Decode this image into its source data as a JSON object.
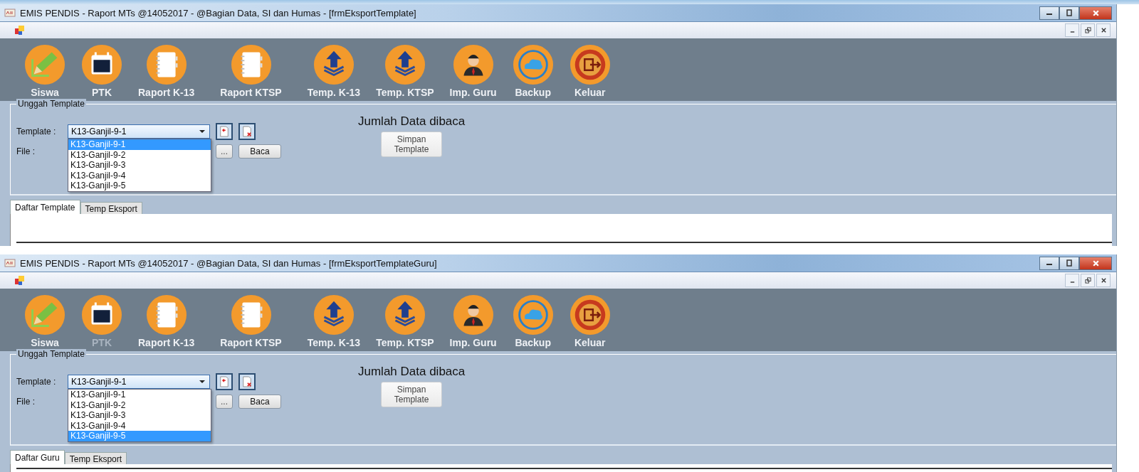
{
  "windows": [
    {
      "title": "EMIS PENDIS - Raport MTs @14052017 - @Bagian Data, SI dan Humas - [frmEksportTemplate]",
      "toolbar": [
        {
          "label": "Siswa",
          "kind": "pencil",
          "disabled": false
        },
        {
          "label": "PTK",
          "kind": "calendar",
          "disabled": false
        },
        {
          "label": "Raport K-13",
          "kind": "notebook",
          "disabled": false
        },
        {
          "label": "Raport KTSP",
          "kind": "notebook",
          "disabled": false
        },
        {
          "label": "Temp. K-13",
          "kind": "upload",
          "disabled": false
        },
        {
          "label": "Temp. KTSP",
          "kind": "upload",
          "disabled": false
        },
        {
          "label": "Imp. Guru",
          "kind": "person",
          "disabled": false
        },
        {
          "label": "Backup",
          "kind": "cloud",
          "disabled": false
        },
        {
          "label": "Keluar",
          "kind": "exit",
          "disabled": false
        }
      ],
      "group": {
        "title": "Unggah Template",
        "template_label": "Template :",
        "template_value": "K13-Ganjil-9-1",
        "file_label": "File :",
        "browse_button": "...",
        "read_button": "Baca",
        "count_label": "Jumlah Data dibaca",
        "save_button": "Simpan Template"
      },
      "options": [
        {
          "label": "K13-Ganjil-9-1",
          "selected": true
        },
        {
          "label": "K13-Ganjil-9-2",
          "selected": false
        },
        {
          "label": "K13-Ganjil-9-3",
          "selected": false
        },
        {
          "label": "K13-Ganjil-9-4",
          "selected": false
        },
        {
          "label": "K13-Ganjil-9-5",
          "selected": false
        }
      ],
      "tabs": [
        {
          "label": "Daftar Template",
          "selected": true
        },
        {
          "label": "Temp Eksport",
          "selected": false
        }
      ]
    },
    {
      "title": "EMIS PENDIS - Raport MTs @14052017 - @Bagian Data, SI dan Humas - [frmEksportTemplateGuru]",
      "toolbar": [
        {
          "label": "Siswa",
          "kind": "pencil",
          "disabled": false
        },
        {
          "label": "PTK",
          "kind": "calendar",
          "disabled": true
        },
        {
          "label": "Raport K-13",
          "kind": "notebook",
          "disabled": false
        },
        {
          "label": "Raport KTSP",
          "kind": "notebook",
          "disabled": false
        },
        {
          "label": "Temp. K-13",
          "kind": "upload",
          "disabled": false
        },
        {
          "label": "Temp. KTSP",
          "kind": "upload",
          "disabled": false
        },
        {
          "label": "Imp. Guru",
          "kind": "person",
          "disabled": false
        },
        {
          "label": "Backup",
          "kind": "cloud",
          "disabled": false
        },
        {
          "label": "Keluar",
          "kind": "exit",
          "disabled": false
        }
      ],
      "group": {
        "title": "Unggah Template",
        "template_label": "Template :",
        "template_value": "K13-Ganjil-9-1",
        "file_label": "File :",
        "browse_button": "...",
        "read_button": "Baca",
        "count_label": "Jumlah Data dibaca",
        "save_button": "Simpan Template"
      },
      "options": [
        {
          "label": "K13-Ganjil-9-1",
          "selected": false
        },
        {
          "label": "K13-Ganjil-9-2",
          "selected": false
        },
        {
          "label": "K13-Ganjil-9-3",
          "selected": false
        },
        {
          "label": "K13-Ganjil-9-4",
          "selected": false
        },
        {
          "label": "K13-Ganjil-9-5",
          "selected": true
        }
      ],
      "tabs": [
        {
          "label": "Daftar Guru",
          "selected": true
        },
        {
          "label": "Temp Eksport",
          "selected": false
        }
      ]
    }
  ]
}
